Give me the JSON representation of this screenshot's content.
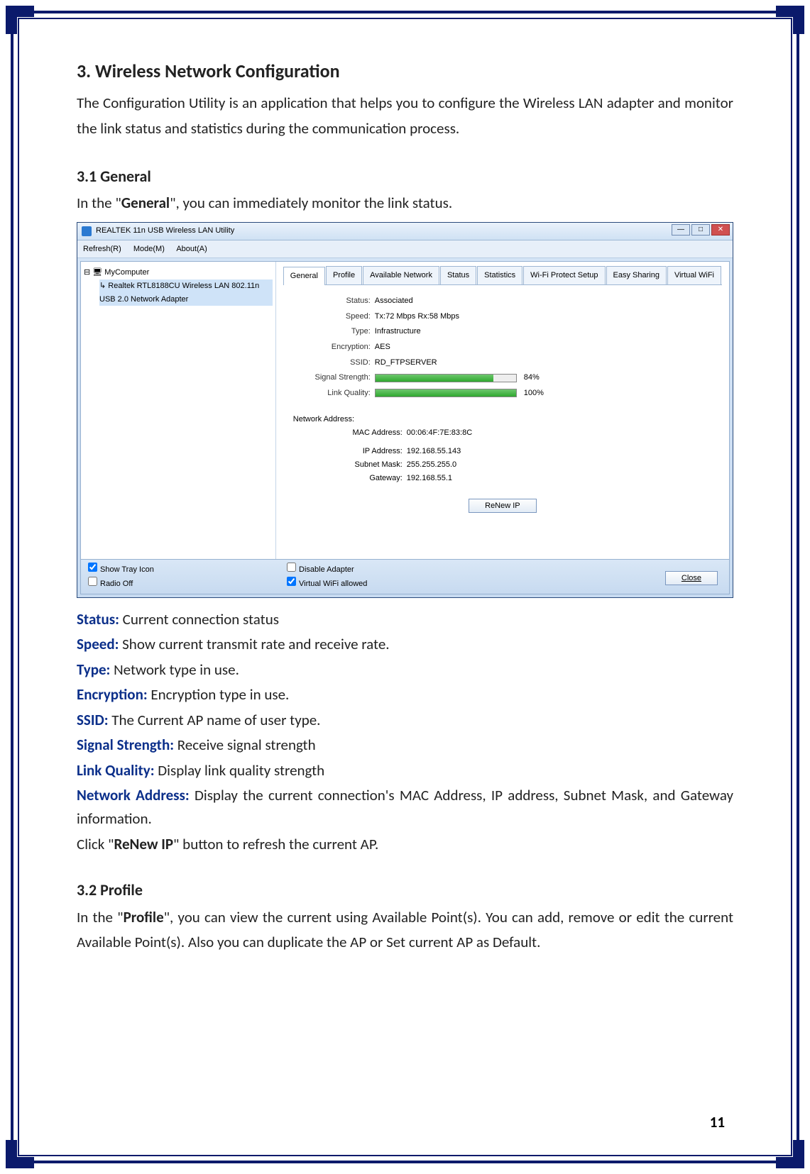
{
  "headings": {
    "h1": "3.   Wireless Network Configuration",
    "h2a": "3.1   General",
    "h2b": "3.2   Profile"
  },
  "paras": {
    "p1": "The Configuration Utility is an application that helps you to configure the Wireless LAN adapter and monitor the link status and statistics during the communication process.",
    "p2a": "In the \"",
    "p2b": "General",
    "p2c": "\", you can immediately monitor the link status.",
    "p3a": "In the \"",
    "p3b": "Profile",
    "p3c": "\", you can view the current using Available Point(s). You can add, remove or edit the current Available Point(s). Also you can duplicate the AP or Set current AP as Default."
  },
  "app": {
    "title": "REALTEK 11n USB Wireless LAN Utility",
    "menu": {
      "refresh": "Refresh(R)",
      "mode": "Mode(M)",
      "about": "About(A)"
    },
    "tree": {
      "root": "MyComputer",
      "child": "Realtek RTL8188CU Wireless LAN 802.11n USB 2.0 Network Adapter"
    },
    "tabs": [
      "General",
      "Profile",
      "Available Network",
      "Status",
      "Statistics",
      "Wi-Fi Protect Setup",
      "Easy Sharing",
      "Virtual WiFi"
    ],
    "status": {
      "status_l": "Status:",
      "status_v": "Associated",
      "speed_l": "Speed:",
      "speed_v": "Tx:72 Mbps Rx:58 Mbps",
      "type_l": "Type:",
      "type_v": "Infrastructure",
      "enc_l": "Encryption:",
      "enc_v": "AES",
      "ssid_l": "SSID:",
      "ssid_v": "RD_FTPSERVER",
      "sig_l": "Signal Strength:",
      "sig_p": "84%",
      "sig_w": 84,
      "lq_l": "Link Quality:",
      "lq_p": "100%",
      "lq_w": 100
    },
    "netaddr": {
      "title": "Network Address:",
      "mac_l": "MAC Address:",
      "mac_v": "00:06:4F:7E:83:8C",
      "ip_l": "IP Address:",
      "ip_v": "192.168.55.143",
      "sn_l": "Subnet Mask:",
      "sn_v": "255.255.255.0",
      "gw_l": "Gateway:",
      "gw_v": "192.168.55.1"
    },
    "renew": "ReNew IP",
    "footer": {
      "tray": "Show Tray Icon",
      "radio": "Radio Off",
      "dis": "Disable Adapter",
      "vwifi": "Virtual WiFi allowed",
      "close": "Close"
    }
  },
  "defs": {
    "status_t": "Status:",
    "status_d": " Current connection status",
    "speed_t": "Speed:",
    "speed_d": " Show current transmit rate and receive rate.",
    "type_t": "Type:",
    "type_d": " Network type in use.",
    "enc_t": "Encryption:",
    "enc_d": " Encryption type in use.",
    "ssid_t": "SSID:",
    "ssid_d": " The Current AP name of user type.",
    "sig_t": "Signal Strength:",
    "sig_d": " Receive signal strength",
    "lq_t": "Link Quality:",
    "lq_d": " Display link quality strength",
    "na_t": "Network Address:",
    "na_d": " Display the current connection's MAC Address, IP address, Subnet Mask, and Gateway information.",
    "renew_a": "Click \"",
    "renew_b": "ReNew IP",
    "renew_c": "\" button to refresh the current AP."
  },
  "page_num": "11"
}
